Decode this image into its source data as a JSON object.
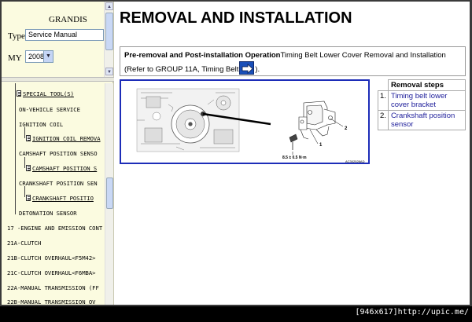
{
  "sidebar": {
    "model": "GRANDIS",
    "type_label": "Type",
    "type_value": "Service Manual",
    "my_label": "MY",
    "my_value": "2008",
    "tree": [
      {
        "label": "SPECIAL TOOL(S)",
        "link": true,
        "doc": true
      },
      {
        "label": "ON-VEHICLE SERVICE",
        "link": false,
        "doc": false
      },
      {
        "label": "IGNITION COIL",
        "link": false,
        "doc": false
      },
      {
        "label": "IGNITION COIL REMOVA",
        "link": true,
        "doc": true
      },
      {
        "label": "CAMSHAFT POSITION SENSO",
        "link": false,
        "doc": false
      },
      {
        "label": "CAMSHAFT POSITION S",
        "link": true,
        "doc": true
      },
      {
        "label": "CRANKSHAFT POSITION SEN",
        "link": false,
        "doc": false
      },
      {
        "label": "CRANKSHAFT POSITIO",
        "link": true,
        "doc": true
      },
      {
        "label": "DETONATION SENSOR",
        "link": false,
        "doc": false
      },
      {
        "label": "17 -ENGINE AND EMISSION CONT",
        "link": false,
        "doc": false
      },
      {
        "label": "21A-CLUTCH",
        "link": false,
        "doc": false
      },
      {
        "label": "21B-CLUTCH OVERHAUL<F5M42>",
        "link": false,
        "doc": false
      },
      {
        "label": "21C-CLUTCH OVERHAUL<F6MBA>",
        "link": false,
        "doc": false
      },
      {
        "label": "22A-MANUAL TRANSMISSION (FF",
        "link": false,
        "doc": false
      },
      {
        "label": "22B-MANUAL TRANSMISSION OV",
        "link": false,
        "doc": false
      }
    ]
  },
  "content": {
    "title": "REMOVAL AND INSTALLATION",
    "pre_bold": "Pre-removal and Post-installation Operation",
    "pre_text": "Timing Belt Lower Cover Removal and Installation",
    "pre_ref": "(Refer to GROUP 11A, Timing Belt",
    "pre_close": ").",
    "figure": {
      "label_1": "1",
      "label_2": "2",
      "torque": "8.5 ± 0.5 N·m",
      "code": "AC302528AD"
    },
    "steps_header": "Removal steps",
    "steps": [
      {
        "num": "1.",
        "text": "Timing belt lower cover bracket"
      },
      {
        "num": "2.",
        "text": "Crankshaft position sensor"
      }
    ]
  },
  "watermark": "[946x617]http://upic.me/",
  "colors": {
    "sidebar_bg": "#fbfbe0",
    "figure_border": "#1d2db8",
    "go_button": "#1a4fb8"
  }
}
